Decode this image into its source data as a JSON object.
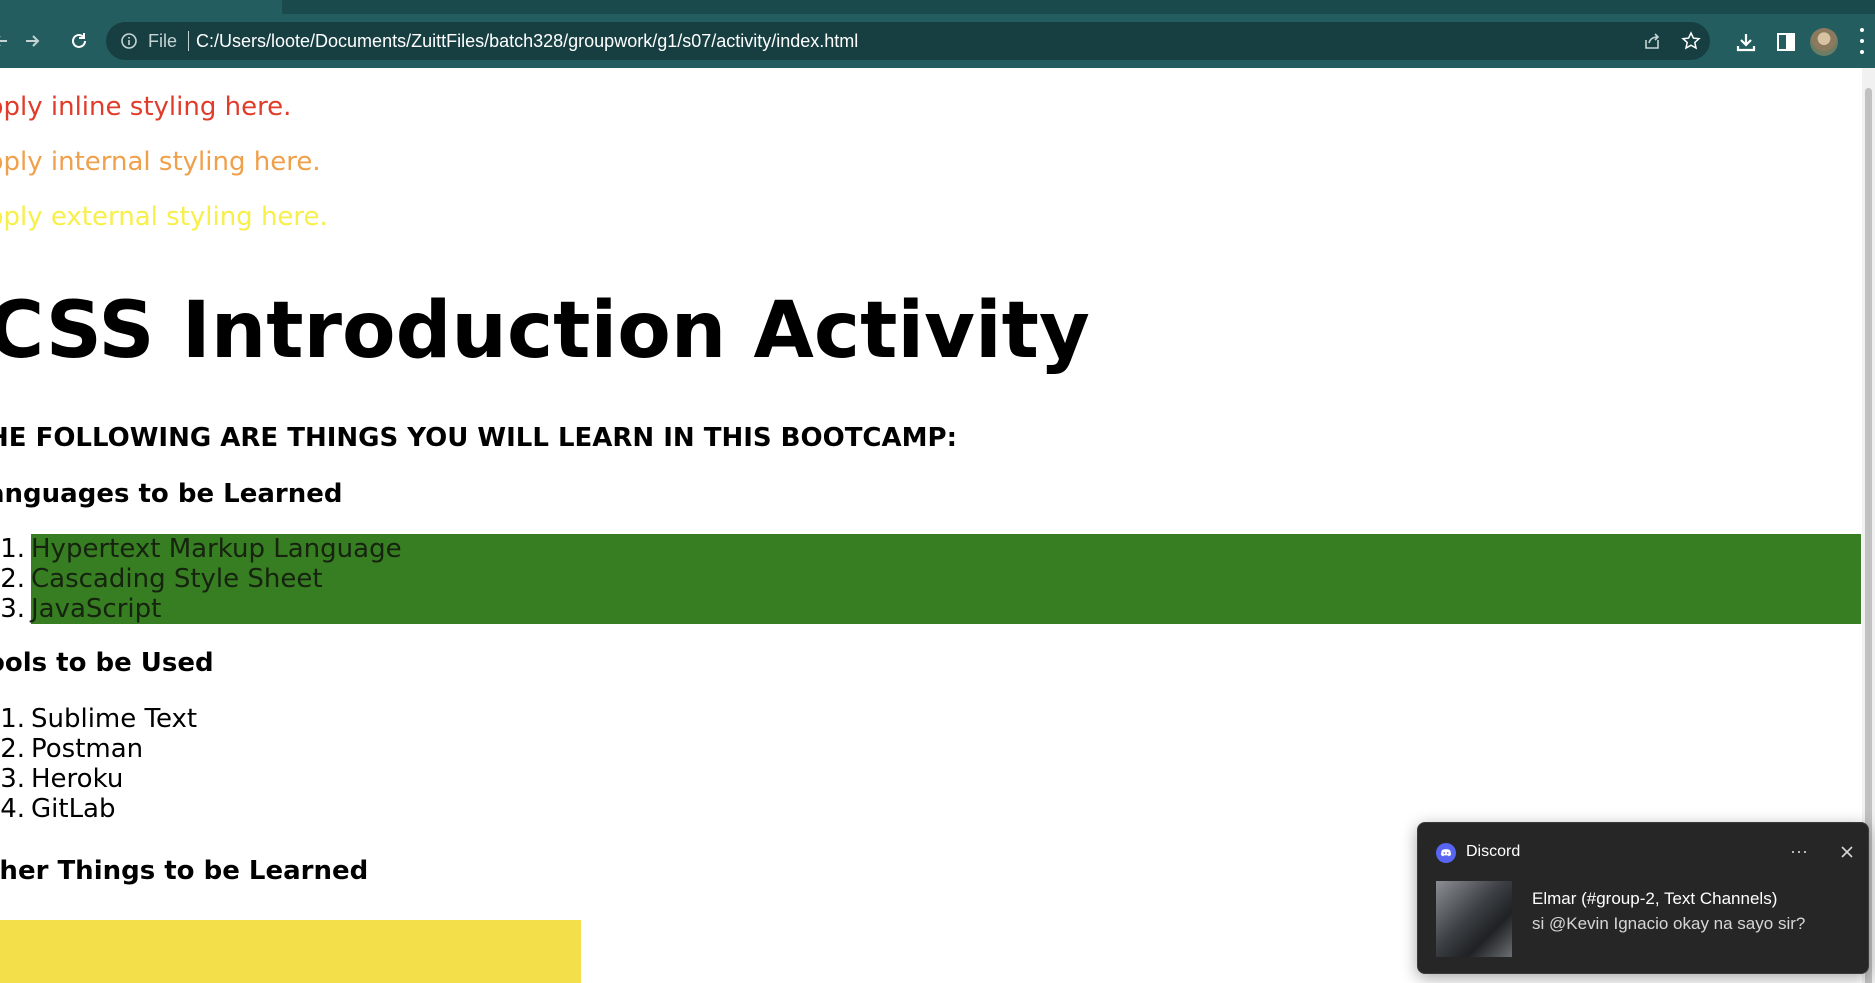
{
  "browser": {
    "scheme_label": "File",
    "url": "C:/Users/loote/Documents/ZuittFiles/batch328/groupwork/g1/s07/activity/index.html",
    "theme_color": "#235d5f"
  },
  "page": {
    "para_inline": "pply inline styling here.",
    "para_internal": "pply internal styling here.",
    "para_external": "pply external styling here.",
    "heading_main": "CSS Introduction Activity",
    "heading_sub": "HE FOLLOWING ARE THINGS YOU WILL LEARN IN THIS BOOTCAMP:",
    "languages": {
      "heading": "anguages to be Learned",
      "items": [
        {
          "num": "1.",
          "label": "Hypertext Markup Language"
        },
        {
          "num": "2.",
          "label": "Cascading Style Sheet"
        },
        {
          "num": "3.",
          "label": "JavaScript"
        }
      ],
      "background": "#377d22"
    },
    "tools": {
      "heading": "ools to be Used",
      "items": [
        {
          "num": "1.",
          "label": "Sublime Text"
        },
        {
          "num": "2.",
          "label": "Postman"
        },
        {
          "num": "3.",
          "label": "Heroku"
        },
        {
          "num": "4.",
          "label": "GitLab"
        }
      ]
    },
    "other": {
      "heading": "ther Things to be Learned",
      "background": "#f2df4a"
    },
    "colors": {
      "inline": "#e03c2a",
      "internal": "#f0a04b",
      "external": "#f7ef4a"
    }
  },
  "notification": {
    "app": "Discord",
    "more_label": "···",
    "title": "Elmar (#group-2, Text Channels)",
    "message": "si @Kevin Ignacio okay na sayo sir?",
    "accent": "#5865f2"
  }
}
